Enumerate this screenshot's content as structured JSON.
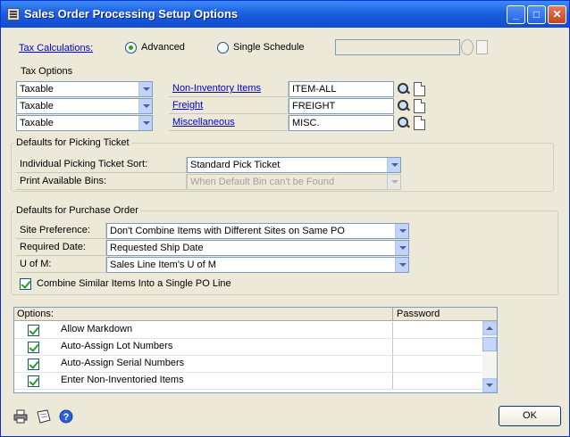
{
  "window": {
    "title": "Sales Order Processing Setup Options",
    "buttons": [
      "_",
      "□",
      "✕"
    ]
  },
  "tax": {
    "calculations_label": "Tax Calculations:",
    "radio_advanced": "Advanced",
    "radio_single_schedule": "Single Schedule",
    "selected": "Advanced",
    "schedule_value": "",
    "options_label": "Tax Options",
    "option_selects": [
      "Taxable",
      "Taxable",
      "Taxable"
    ],
    "items": [
      {
        "label": "Non-Inventory Items",
        "value": "ITEM-ALL"
      },
      {
        "label": "Freight",
        "value": "FREIGHT"
      },
      {
        "label": "Miscellaneous",
        "value": "MISC."
      }
    ]
  },
  "picking": {
    "group_label": "Defaults for Picking Ticket",
    "sort_label": "Individual Picking Ticket Sort:",
    "sort_value": "Standard Pick Ticket",
    "bins_label": "Print Available Bins:",
    "bins_value": "When Default Bin can't be Found"
  },
  "purchase": {
    "group_label": "Defaults for Purchase Order",
    "site_label": "Site Preference:",
    "site_value": "Don't Combine Items with Different Sites on Same PO",
    "date_label": "Required Date:",
    "date_value": "Requested Ship Date",
    "uofm_label": "U of M:",
    "uofm_value": "Sales Line Item's U of M",
    "combine_label": "Combine Similar Items Into a Single PO Line",
    "combine_checked": true
  },
  "options_grid": {
    "col_options": "Options:",
    "col_password": "Password",
    "rows": [
      {
        "label": "Allow Markdown",
        "checked": true,
        "password": ""
      },
      {
        "label": "Auto-Assign Lot Numbers",
        "checked": true,
        "password": ""
      },
      {
        "label": "Auto-Assign Serial Numbers",
        "checked": true,
        "password": ""
      },
      {
        "label": "Enter Non-Inventoried Items",
        "checked": true,
        "password": ""
      }
    ]
  },
  "footer": {
    "ok_label": "OK",
    "icons": [
      "printer-icon",
      "note-icon",
      "help-icon"
    ]
  }
}
